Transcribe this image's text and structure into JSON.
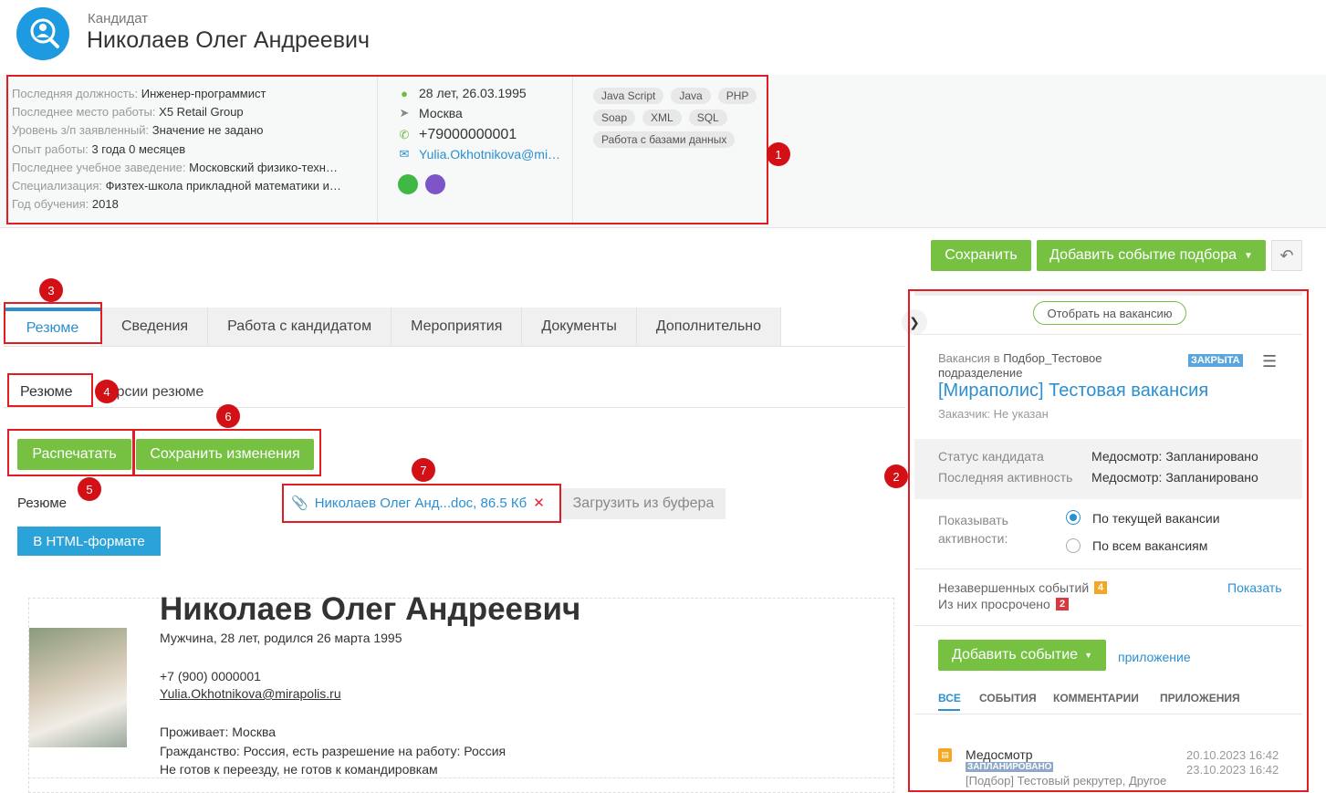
{
  "header": {
    "kind": "Кандидат",
    "full_name": "Николаев Олег Андреевич"
  },
  "info": {
    "rows": [
      {
        "label": "Последняя должность:",
        "value": "Инженер-программист"
      },
      {
        "label": "Последнее место работы:",
        "value": "X5 Retail Group"
      },
      {
        "label": "Уровень з/п заявленный:",
        "value": "Значение не задано"
      },
      {
        "label": "Опыт работы:",
        "value": "3 года 0 месяцев"
      },
      {
        "label": "Последнее учебное заведение:",
        "value": "Московский физико-техн…"
      },
      {
        "label": "Специализация:",
        "value": "Физтех-школа прикладной математики и…"
      },
      {
        "label": "Год обучения:",
        "value": "2018"
      }
    ],
    "age": "28 лет, 26.03.1995",
    "city": "Москва",
    "phone": "+79000000001",
    "email": "Yulia.Okhotnikova@mi…",
    "skills": [
      "Java Script",
      "Java",
      "PHP",
      "Soap",
      "XML",
      "SQL",
      "Работа с базами данных"
    ]
  },
  "markers": [
    "1",
    "2",
    "3",
    "4",
    "5",
    "6",
    "7"
  ],
  "toolbar": {
    "save": "Сохранить",
    "add_event": "Добавить событие подбора"
  },
  "tabs": [
    "Резюме",
    "Сведения",
    "Работа с кандидатом",
    "Мероприятия",
    "Документы",
    "Дополнительно"
  ],
  "subtabs": {
    "resume": "Резюме",
    "versions": "Версии резюме"
  },
  "actions": {
    "print": "Распечатать",
    "save_changes": "Сохранить изменения"
  },
  "resume_row": {
    "label": "Резюме",
    "file": "Николаев Олег Анд...doc, 86.5 Кб",
    "paste": "Загрузить из буфера",
    "html": "В HTML-формате"
  },
  "resume_doc": {
    "name": "Николаев Олег Андреевич",
    "meta": "Мужчина, 28 лет, родился 26 марта 1995",
    "phone": "+7 (900) 0000001",
    "email": "Yulia.Okhotnikova@mirapolis.ru",
    "city": "Проживает: Москва",
    "citizenship": "Гражданство: Россия, есть разрешение на работу: Россия",
    "relocation": "Не готов к переезду, не готов к командировкам"
  },
  "right": {
    "select_btn": "Отобрать на вакансию",
    "vacancy_prefix": "Вакансия в",
    "vacancy_dept": "Подбор_Тестовое подразделение",
    "status_badge": "ЗАКРЫТА",
    "vacancy_title": "[Мираполис] Тестовая вакансия",
    "customer": "Заказчик: Не указан",
    "status_lbl": "Статус кандидата",
    "status_val": "Медосмотр: Запланировано",
    "activity_lbl": "Последняя активность",
    "activity_val": "Медосмотр: Запланировано",
    "show_lbl": "Показывать активности:",
    "opt_current": "По текущей вакансии",
    "opt_all": "По всем вакансиям",
    "unfinished_lbl": "Незавершенных событий",
    "unfinished_count": "4",
    "overdue_lbl": "Из них просрочено",
    "overdue_count": "2",
    "show_link": "Показать",
    "add_event": "Добавить событие",
    "app_link": "приложение",
    "filters": [
      "ВСЕ",
      "СОБЫТИЯ",
      "КОММЕНТАРИИ",
      "ПРИЛОЖЕНИЯ"
    ],
    "event": {
      "title": "Медосмотр",
      "badge": "ЗАПЛАНИРОВАНО",
      "author": "[Подбор] Тестовый рекрутер, Другое",
      "date1": "20.10.2023 16:42",
      "date2": "23.10.2023 16:42"
    }
  },
  "colors": {
    "green": "#76c142",
    "blue": "#2c8fcf",
    "red_marker": "#d21016"
  }
}
